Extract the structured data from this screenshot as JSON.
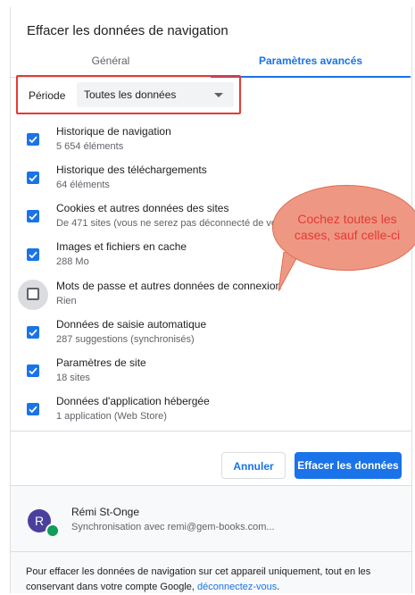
{
  "window": {
    "title": "Effacer les données de navigation"
  },
  "tabs": [
    {
      "label": "Général"
    },
    {
      "label": "Paramètres avancés"
    }
  ],
  "period": {
    "label": "Période",
    "value": "Toutes les données"
  },
  "items": [
    {
      "title": "Historique de navigation",
      "sub": "5 654 éléments",
      "checked": true
    },
    {
      "title": "Historique des téléchargements",
      "sub": "64 éléments",
      "checked": true
    },
    {
      "title": "Cookies et autres données des sites",
      "sub": "De 471 sites (vous ne serez pas déconnecté de vo",
      "checked": true
    },
    {
      "title": "Images et fichiers en cache",
      "sub": "288 Mo",
      "checked": true
    },
    {
      "title": "Mots de passe et autres données de connexion",
      "sub": "Rien",
      "checked": false
    },
    {
      "title": "Données de saisie automatique",
      "sub": "287 suggestions (synchronisés)",
      "checked": true
    },
    {
      "title": "Paramètres de site",
      "sub": "18 sites",
      "checked": true
    },
    {
      "title": "Données d'application hébergée",
      "sub": "1 application (Web Store)",
      "checked": true
    }
  ],
  "buttons": {
    "cancel": "Annuler",
    "clear": "Effacer les données"
  },
  "account": {
    "initial": "R",
    "name": "Rémi St-Onge",
    "sync": "Synchronisation avec remi@gem-books.com..."
  },
  "info": {
    "text": "Pour effacer les données de navigation sur cet appareil uniquement, tout en les conservant dans votre compte Google, ",
    "link": "déconnectez-vous",
    "end": "."
  },
  "callout": {
    "text": "Cochez toutes les cases, sauf celle-ci"
  },
  "colors": {
    "accent": "#1a73e8",
    "highlight": "#e53935",
    "callout_fill": "#ee9884"
  }
}
